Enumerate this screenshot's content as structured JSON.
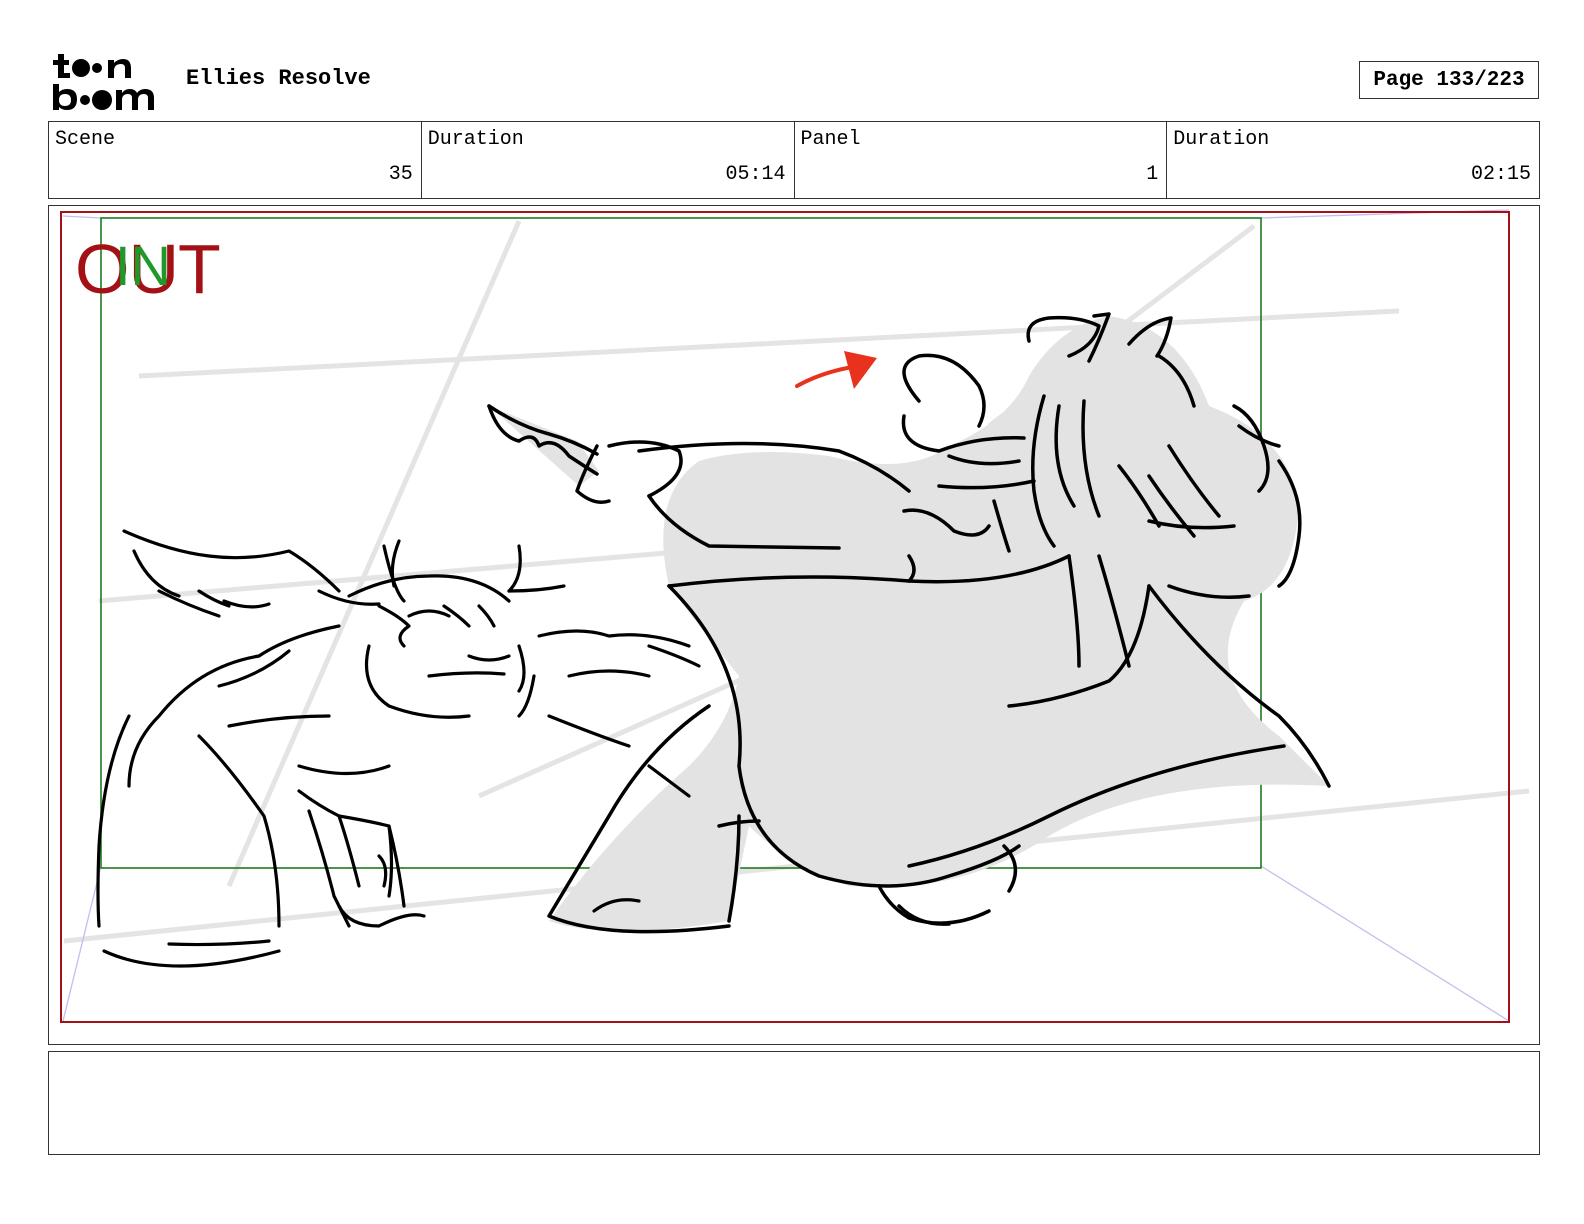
{
  "header": {
    "logo_text": "toon boom",
    "project_title": "Ellies Resolve",
    "page_label": "Page 133/223"
  },
  "info": [
    {
      "label": "Scene",
      "value": "35"
    },
    {
      "label": "Duration",
      "value": "05:14"
    },
    {
      "label": "Panel",
      "value": "1"
    },
    {
      "label": "Duration",
      "value": "02:15"
    }
  ],
  "panel": {
    "out_label": "OUT",
    "in_label": "IN",
    "colors": {
      "out_frame": "#a31015",
      "in_frame": "#1f7a1f",
      "arrow": "#e8321e",
      "fill": "#e3e3e3",
      "perspective": "#b9b4e6"
    }
  },
  "notes": {
    "text": ""
  }
}
